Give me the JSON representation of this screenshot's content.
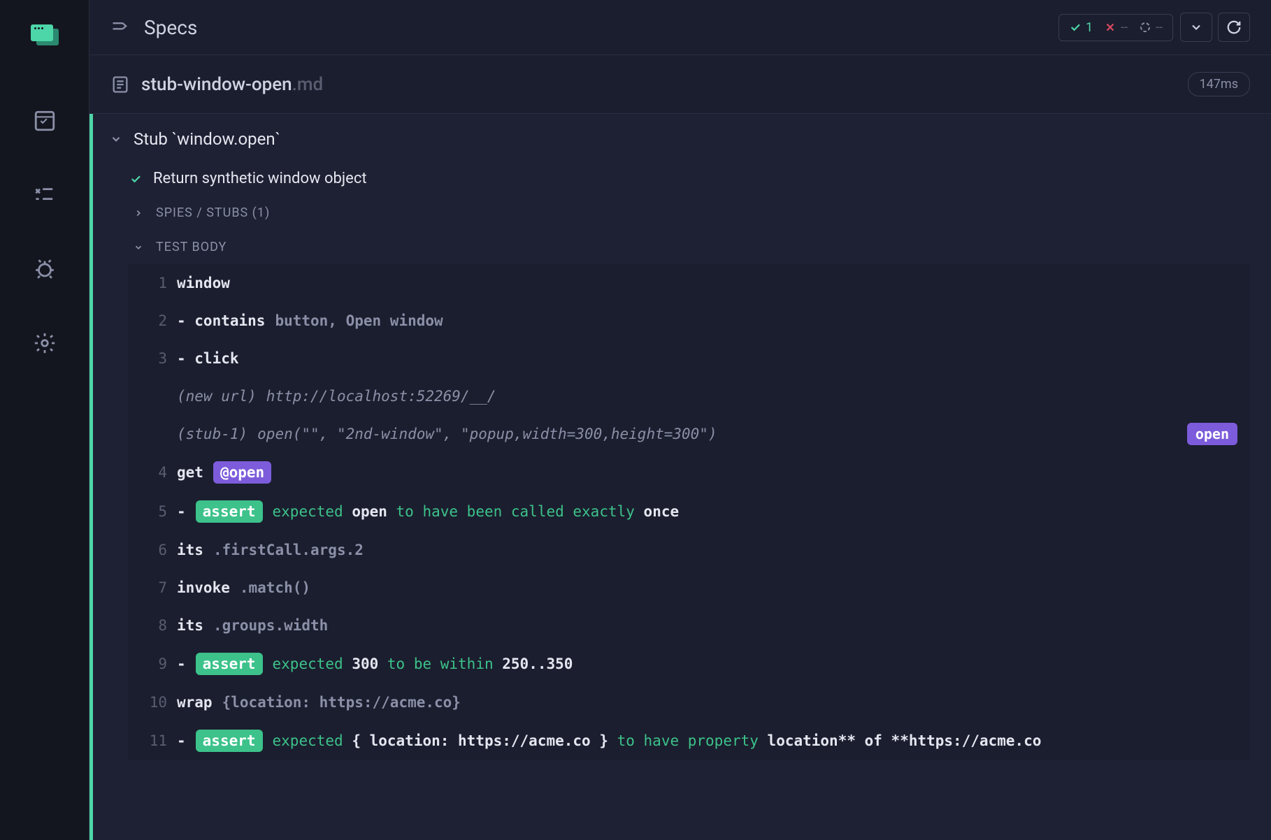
{
  "header": {
    "title": "Specs",
    "passed": "1",
    "failed": "--",
    "pending": "--"
  },
  "file": {
    "name": "stub-window-open",
    "ext": ".md",
    "duration": "147ms"
  },
  "describe": {
    "title": "Stub `window.open`"
  },
  "test": {
    "title": "Return synthetic window object"
  },
  "sections": {
    "spies": "SPIES / STUBS (1)",
    "body": "TEST BODY"
  },
  "commands": [
    {
      "num": "1",
      "type": "cmd",
      "name": "window",
      "args": ""
    },
    {
      "num": "2",
      "type": "child",
      "name": "contains",
      "args": "button, Open window"
    },
    {
      "num": "3",
      "type": "child",
      "name": "click",
      "args": ""
    },
    {
      "num": "",
      "type": "event",
      "label": "(new url)",
      "value": "http://localhost:52269/__/"
    },
    {
      "num": "",
      "type": "event",
      "label": "(stub-1)",
      "value": "open(\"\", \"2nd-window\", \"popup,width=300,height=300\")",
      "badge": "open"
    },
    {
      "num": "4",
      "type": "cmd",
      "name": "get",
      "tag": "@open"
    },
    {
      "num": "5",
      "type": "assert",
      "pre": "expected ",
      "b1": "open",
      "mid": " to have been called exactly ",
      "b2": "once",
      "post": ""
    },
    {
      "num": "6",
      "type": "cmd",
      "name": "its",
      "args": ".firstCall.args.2"
    },
    {
      "num": "7",
      "type": "cmd",
      "name": "invoke",
      "args": ".match()"
    },
    {
      "num": "8",
      "type": "cmd",
      "name": "its",
      "args": ".groups.width"
    },
    {
      "num": "9",
      "type": "assert",
      "pre": "expected ",
      "b1": "300",
      "mid": " to be within ",
      "b2": "250..350",
      "post": ""
    },
    {
      "num": "10",
      "type": "cmd",
      "name": "wrap",
      "args": "{location: https://acme.co}"
    },
    {
      "num": "11",
      "type": "assert",
      "pre": "expected ",
      "b1": "{ location: https://acme.co }",
      "mid": " to have property ",
      "b2": "location** of **https://acme.co",
      "post": ""
    }
  ]
}
